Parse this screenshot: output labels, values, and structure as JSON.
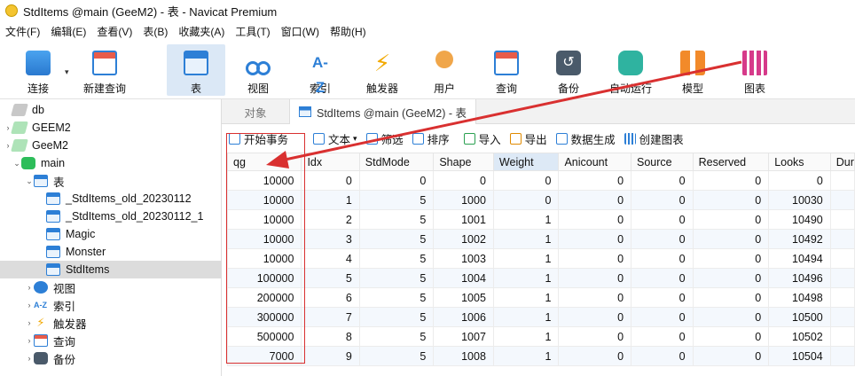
{
  "window": {
    "title": "StdItems @main (GeeM2) - 表 - Navicat Premium"
  },
  "menu": [
    "文件(F)",
    "编辑(E)",
    "查看(V)",
    "表(B)",
    "收藏夹(A)",
    "工具(T)",
    "窗口(W)",
    "帮助(H)"
  ],
  "toolbar": {
    "connect": "连接",
    "new_query": "新建查询",
    "table": "表",
    "view": "视图",
    "index": "索引",
    "trigger": "触发器",
    "user": "用户",
    "query": "查询",
    "backup": "备份",
    "automation": "自动运行",
    "model": "模型",
    "chart": "图表",
    "index_glyph": "A-Z",
    "trigger_glyph": "⚡",
    "backup_glyph": "↺"
  },
  "sidebar": {
    "items": [
      {
        "label": "db",
        "caret": ""
      },
      {
        "label": "GEEM2",
        "caret": "›"
      },
      {
        "label": "GeeM2",
        "caret": "›"
      },
      {
        "label": "main",
        "caret": "⌄"
      },
      {
        "label": "表",
        "caret": "⌄"
      },
      {
        "label": "_StdItems_old_20230112",
        "caret": ""
      },
      {
        "label": "_StdItems_old_20230112_1",
        "caret": ""
      },
      {
        "label": "Magic",
        "caret": ""
      },
      {
        "label": "Monster",
        "caret": ""
      },
      {
        "label": "StdItems",
        "caret": ""
      },
      {
        "label": "视图",
        "caret": "›"
      },
      {
        "label": "索引",
        "caret": "›"
      },
      {
        "label": "触发器",
        "caret": "›"
      },
      {
        "label": "查询",
        "caret": "›"
      },
      {
        "label": "备份",
        "caret": "›"
      }
    ]
  },
  "tabs": {
    "objects": "对象",
    "active": "StdItems @main (GeeM2) - 表"
  },
  "subtoolbar": {
    "begin_transaction": "开始事务",
    "text": "文本",
    "filter": "筛选",
    "sort": "排序",
    "import": "导入",
    "export": "导出",
    "generate_data": "数据生成",
    "create_chart": "创建图表"
  },
  "grid": {
    "columns": [
      "qg",
      "Idx",
      "StdMode",
      "Shape",
      "Weight",
      "Anicount",
      "Source",
      "Reserved",
      "Looks",
      "Dur"
    ],
    "rows": [
      [
        "10000",
        "0",
        "0",
        "0",
        "0",
        "0",
        "0",
        "0",
        "0"
      ],
      [
        "10000",
        "1",
        "5",
        "1000",
        "0",
        "0",
        "0",
        "0",
        "10030"
      ],
      [
        "10000",
        "2",
        "5",
        "1001",
        "1",
        "0",
        "0",
        "0",
        "10490"
      ],
      [
        "10000",
        "3",
        "5",
        "1002",
        "1",
        "0",
        "0",
        "0",
        "10492"
      ],
      [
        "10000",
        "4",
        "5",
        "1003",
        "1",
        "0",
        "0",
        "0",
        "10494"
      ],
      [
        "100000",
        "5",
        "5",
        "1004",
        "1",
        "0",
        "0",
        "0",
        "10496"
      ],
      [
        "200000",
        "6",
        "5",
        "1005",
        "1",
        "0",
        "0",
        "0",
        "10498"
      ],
      [
        "300000",
        "7",
        "5",
        "1006",
        "1",
        "0",
        "0",
        "0",
        "10500"
      ],
      [
        "500000",
        "8",
        "5",
        "1007",
        "1",
        "0",
        "0",
        "0",
        "10502"
      ],
      [
        "7000",
        "9",
        "5",
        "1008",
        "1",
        "0",
        "0",
        "0",
        "10504"
      ]
    ]
  },
  "colors": {
    "annotation": "#d93030",
    "selection": "#dcdcdc",
    "accent": "#2d7fd6"
  }
}
